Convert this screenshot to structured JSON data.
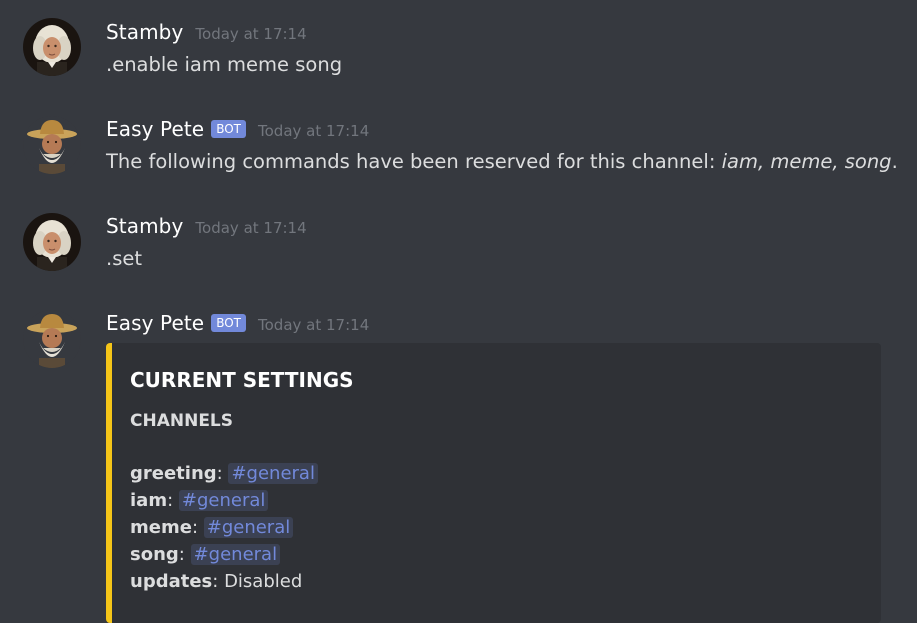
{
  "messages": [
    {
      "author": "Stamby",
      "timestamp": "Today at 17:14",
      "text": ".enable iam meme song",
      "avatar": "bach-portrait-icon"
    },
    {
      "author": "Easy Pete",
      "bot_tag": "BOT",
      "timestamp": "Today at 17:14",
      "text_prefix": "The following commands have been reserved for this channel: ",
      "text_italic": "iam, meme, song",
      "text_suffix": ".",
      "avatar": "cowboy-old-man-icon"
    },
    {
      "author": "Stamby",
      "timestamp": "Today at 17:14",
      "text": ".set",
      "avatar": "bach-portrait-icon"
    },
    {
      "author": "Easy Pete",
      "bot_tag": "BOT",
      "timestamp": "Today at 17:14",
      "avatar": "cowboy-old-man-icon",
      "embed": {
        "accent_color": "#f5c518",
        "title": "CURRENT SETTINGS",
        "subtitle": "CHANNELS",
        "fields": [
          {
            "name": "greeting",
            "sep": ": ",
            "value": "#general",
            "mention": true
          },
          {
            "name": "iam",
            "sep": ": ",
            "value": "#general",
            "mention": true
          },
          {
            "name": "meme",
            "sep": ": ",
            "value": "#general",
            "mention": true
          },
          {
            "name": "song",
            "sep": ": ",
            "value": "#general",
            "mention": true
          },
          {
            "name": "updates",
            "sep": ": ",
            "value": "Disabled",
            "mention": false
          }
        ]
      }
    }
  ],
  "colors": {
    "background": "#36393f",
    "embed_bg": "#2f3136",
    "bot_tag": "#7289da",
    "mention": "#7289da",
    "timestamp": "#72767d"
  }
}
